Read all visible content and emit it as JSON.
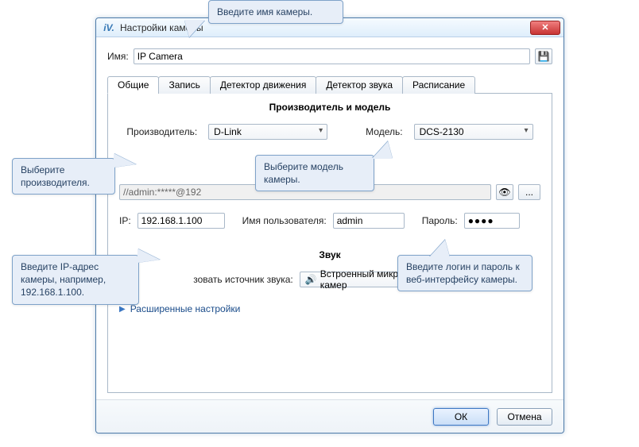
{
  "window": {
    "icon_text": "iV.",
    "title": "Настройки камеры"
  },
  "name_row": {
    "label": "Имя:",
    "value": "IP Camera"
  },
  "tabs": [
    "Общие",
    "Запись",
    "Детектор движения",
    "Детектор звука",
    "Расписание"
  ],
  "general": {
    "group1_title": "Производитель и модель",
    "manufacturer_label": "Производитель:",
    "manufacturer_value": "D-Link",
    "model_label": "Модель:",
    "model_value": "DCS-2130",
    "url_value": "//admin:*****@192",
    "url_more": "...",
    "ip_label": "IP:",
    "ip_value": "192.168.1.100",
    "user_label": "Имя пользователя:",
    "user_value": "admin",
    "pass_label": "Пароль:",
    "pass_value": "●●●●",
    "group2_title": "Звук",
    "sound_src_label": "зовать источник звука:",
    "sound_src_value": "Встроенный микрофон камер",
    "advanced_label": "Расширенные настройки"
  },
  "footer": {
    "ok": "ОК",
    "cancel": "Отмена"
  },
  "callouts": {
    "name": "Введите имя камеры.",
    "manuf": "Выберите производителя.",
    "model": "Выберите модель камеры.",
    "ip": "Введите IP-адрес камеры, например, 192.168.1.100.",
    "login": "Введите логин и пароль к веб-интерфейсу камеры."
  }
}
